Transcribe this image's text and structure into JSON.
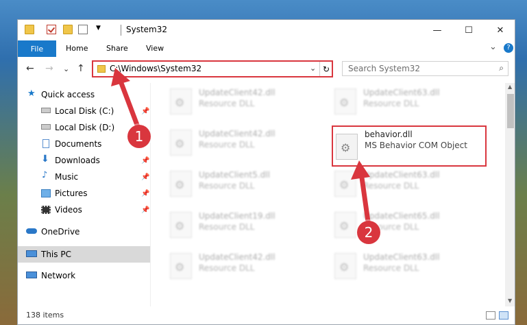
{
  "titlebar": {
    "title": "System32",
    "minimize": "—",
    "maximize": "☐",
    "close": "✕"
  },
  "ribbon": {
    "tabs": [
      "File",
      "Home",
      "Share",
      "View"
    ],
    "expand": "⌄",
    "help": "?"
  },
  "navbar": {
    "back": "←",
    "forward": "→",
    "recent": "⌄",
    "up": "↑",
    "address": "C:\\Windows\\System32",
    "address_dropdown": "⌄",
    "refresh": "↻",
    "search_placeholder": "Search System32",
    "search_icon": "⌕"
  },
  "nav": {
    "items": [
      {
        "label": "Quick access",
        "icon": "star-icon"
      },
      {
        "label": "Local Disk (C:)",
        "icon": "drive-icon",
        "pinned": true
      },
      {
        "label": "Local Disk (D:)",
        "icon": "drive-icon"
      },
      {
        "label": "Documents",
        "icon": "documents-icon"
      },
      {
        "label": "Downloads",
        "icon": "download-icon",
        "pinned": true
      },
      {
        "label": "Music",
        "icon": "music-icon",
        "pinned": true
      },
      {
        "label": "Pictures",
        "icon": "pictures-icon",
        "pinned": true
      },
      {
        "label": "Videos",
        "icon": "videos-icon",
        "pinned": true
      },
      {
        "label": "OneDrive",
        "icon": "cloud-icon"
      },
      {
        "label": "This PC",
        "icon": "computer-icon",
        "selected": true
      },
      {
        "label": "Network",
        "icon": "network-icon"
      }
    ],
    "pin_glyph": "📌"
  },
  "files": [
    {
      "name": "UpdateClient42.dll",
      "type": "Resource DLL"
    },
    {
      "name": "UpdateClient63.dll",
      "type": "Resource DLL"
    },
    {
      "name": "UpdateClient42.dll",
      "type": "Resource DLL"
    },
    {
      "name": "behavior.dll",
      "type": "MS Behavior COM Object",
      "highlighted": true
    },
    {
      "name": "UpdateClient5.dll",
      "type": "Resource DLL"
    },
    {
      "name": "UpdateClient63.dll",
      "type": "Resource DLL"
    },
    {
      "name": "UpdateClient19.dll",
      "type": "Resource DLL"
    },
    {
      "name": "UpdateClient65.dll",
      "type": "Resource DLL"
    },
    {
      "name": "UpdateClient42.dll",
      "type": "Resource DLL"
    },
    {
      "name": "UpdateClient63.dll",
      "type": "Resource DLL"
    }
  ],
  "status": {
    "item_count": "138 items"
  },
  "annotations": {
    "step1": "1",
    "step2": "2",
    "color": "#d9363e"
  }
}
